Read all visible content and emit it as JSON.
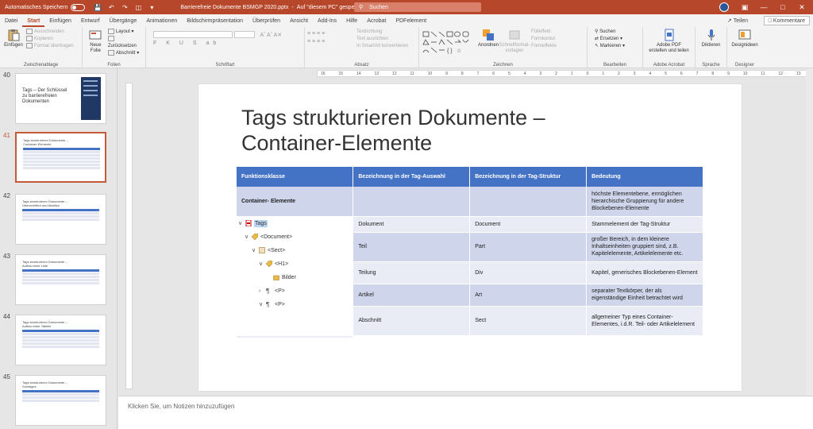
{
  "titlebar": {
    "autosave": "Automatisches Speichern",
    "filename": "Barrierefreie Dokumente BSMGP 2020.pptx",
    "location": "Auf \"diesem PC\" gespeichert",
    "search": "Suchen"
  },
  "tabs": [
    "Datei",
    "Start",
    "Einfügen",
    "Entwurf",
    "Übergänge",
    "Animationen",
    "Bildschirmpräsentation",
    "Überprüfen",
    "Ansicht",
    "Add-Ins",
    "Hilfe",
    "Acrobat",
    "PDFelement"
  ],
  "share": "Teilen",
  "comments": "Kommentare",
  "ribbon": {
    "clipboard": {
      "paste": "Einfügen",
      "cut": "Ausschneiden",
      "copy": "Kopieren",
      "format": "Format übertragen",
      "label": "Zwischenablage"
    },
    "slides": {
      "new": "Neue",
      "new2": "Folie",
      "layout": "Layout",
      "reset": "Zurücksetzen",
      "section": "Abschnitt",
      "label": "Folien"
    },
    "font": {
      "label": "Schriftart",
      "buttons": "F K U S ab"
    },
    "paragraph": {
      "textdir": "Textrichtung",
      "align": "Text ausrichten",
      "smartart": "In SmartArt konvertieren",
      "label": "Absatz"
    },
    "drawing": {
      "arrange": "Anordnen",
      "styles1": "Schnellformat-",
      "styles2": "vorlagen",
      "fill": "Fülleffekt",
      "outline": "Formkontur",
      "effects": "Formeffekte",
      "label": "Zeichnen"
    },
    "editing": {
      "find": "Suchen",
      "replace": "Ersetzen",
      "select": "Markieren",
      "label": "Bearbeiten"
    },
    "acrobat": {
      "btn1": "Adobe PDF",
      "btn2": "erstellen und teilen",
      "label": "Adobe Acrobat"
    },
    "voice": {
      "btn": "Diktieren",
      "label": "Sprache"
    },
    "designer": {
      "btn": "Designideen",
      "label": "Designer"
    }
  },
  "thumbnails": [
    {
      "num": "40",
      "text": "Tags – Der Schlüssel zu barrierefreien Dokumenten"
    },
    {
      "num": "41",
      "text": "Tags strukturieren Dokumente – Container-Elemente"
    },
    {
      "num": "42",
      "text": "Tags strukturieren Dokumente – Überschriften und Absätze"
    },
    {
      "num": "43",
      "text": "Tags strukturieren Dokumente – Aufbau einer Liste"
    },
    {
      "num": "44",
      "text": "Tags strukturieren Dokumente – Aufbau einer Tabelle"
    },
    {
      "num": "45",
      "text": "Tags strukturieren Dokumente – Sonstiges"
    }
  ],
  "thumb40_img": "Ihre beste Übersicht jetzt nutzbar",
  "ruler": [
    "16",
    "15",
    "14",
    "13",
    "12",
    "11",
    "10",
    "9",
    "8",
    "7",
    "6",
    "5",
    "4",
    "3",
    "2",
    "1",
    "0",
    "1",
    "2",
    "3",
    "4",
    "5",
    "6",
    "7",
    "8",
    "9",
    "10",
    "11",
    "12",
    "13",
    "14",
    "15",
    "16"
  ],
  "slide": {
    "title": "Tags strukturieren Dokumente – Container-Elemente",
    "headers": [
      "Funktionsklasse",
      "Bezeichnung in der Tag-Auswahl",
      "Bezeichnung in der Tag-Struktur",
      "Bedeutung"
    ],
    "rows": [
      {
        "c1": "Container- Elemente",
        "c2": "",
        "c3": "",
        "c4": "höchste Elementebene, ermöglichen hierarchische Gruppierung für andere Blockebenen-Elemente"
      },
      {
        "c2": "Dokument",
        "c3": "Document",
        "c4": "Stammelement der Tag-Struktur"
      },
      {
        "c2": "Teil",
        "c3": "Part",
        "c4": "großer Bereich, in dem kleinere Inhaltseinheiten gruppiert sind, z.B. Kapitelelemente, Artikelelemente etc."
      },
      {
        "c2": "Teilung",
        "c3": "Div",
        "c4": "Kapitel, generisches Blockebenen-Element"
      },
      {
        "c2": "Artikel",
        "c3": "Art",
        "c4": "separater Textkörper, der als eigenständige Einheit betrachtet wird"
      },
      {
        "c2": "Abschnitt",
        "c3": "Sect",
        "c4": "allgemeiner Typ eines Container-Elementes, i.d.R. Teil- oder Artikelelement"
      }
    ],
    "tree": [
      "Tags",
      "<Document>",
      "<Sect>",
      "<H1>",
      "Bilder",
      "<P>",
      "<P>"
    ]
  },
  "notes": "Klicken Sie, um Notizen hinzuzufügen",
  "colors": {
    "accent": "#b7472a",
    "table_header": "#4472c4",
    "band_dark": "#cfd5ea",
    "band_light": "#e9ebf5"
  }
}
